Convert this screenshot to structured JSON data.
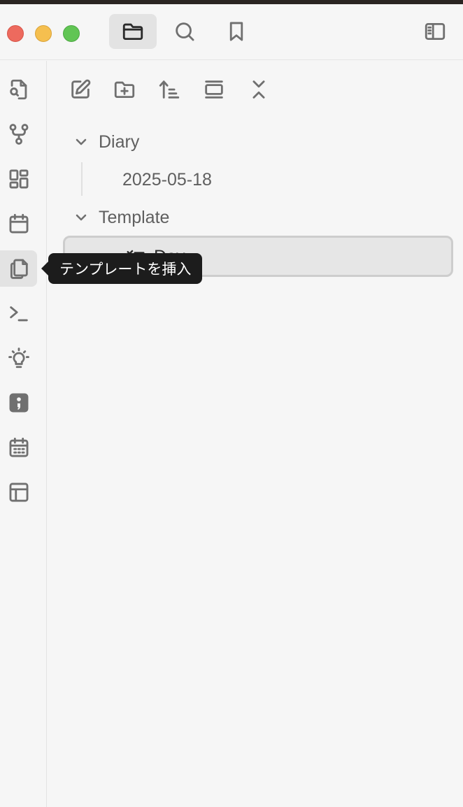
{
  "window": {
    "traffic_lights": [
      "close",
      "minimize",
      "maximize"
    ]
  },
  "titlebar": {
    "tabs": [
      {
        "icon": "folder-icon",
        "active": true
      },
      {
        "icon": "search-icon",
        "active": false
      },
      {
        "icon": "bookmark-icon",
        "active": false
      }
    ],
    "right_icon": "sidebar-toggle-icon"
  },
  "ribbon": {
    "items": [
      {
        "icon": "file-search-icon"
      },
      {
        "icon": "graph-icon"
      },
      {
        "icon": "layout-dashboard-icon"
      },
      {
        "icon": "calendar-icon"
      },
      {
        "icon": "templates-icon",
        "active": true
      },
      {
        "icon": "terminal-icon"
      },
      {
        "icon": "lightbulb-icon"
      },
      {
        "icon": "plugin-badge-icon"
      },
      {
        "icon": "calendar-days-icon"
      },
      {
        "icon": "table-icon"
      }
    ]
  },
  "file_nav": {
    "buttons": [
      "new-note-icon",
      "new-folder-icon",
      "sort-icon",
      "collapse-view-icon",
      "collapse-all-icon"
    ]
  },
  "tree": {
    "folders": [
      {
        "name": "Diary",
        "children": [
          {
            "name": "2025-05-18"
          }
        ]
      },
      {
        "name": "Template",
        "children": [
          {
            "name": "Day"
          }
        ]
      }
    ]
  },
  "tooltip": {
    "text": "テンプレートを挿入"
  },
  "colors": {
    "background": "#f6f6f6",
    "tooltip_bg": "#1c1c1c",
    "close": "#ed6a5e",
    "minimize": "#f5bf4f",
    "maximize": "#61c554"
  }
}
